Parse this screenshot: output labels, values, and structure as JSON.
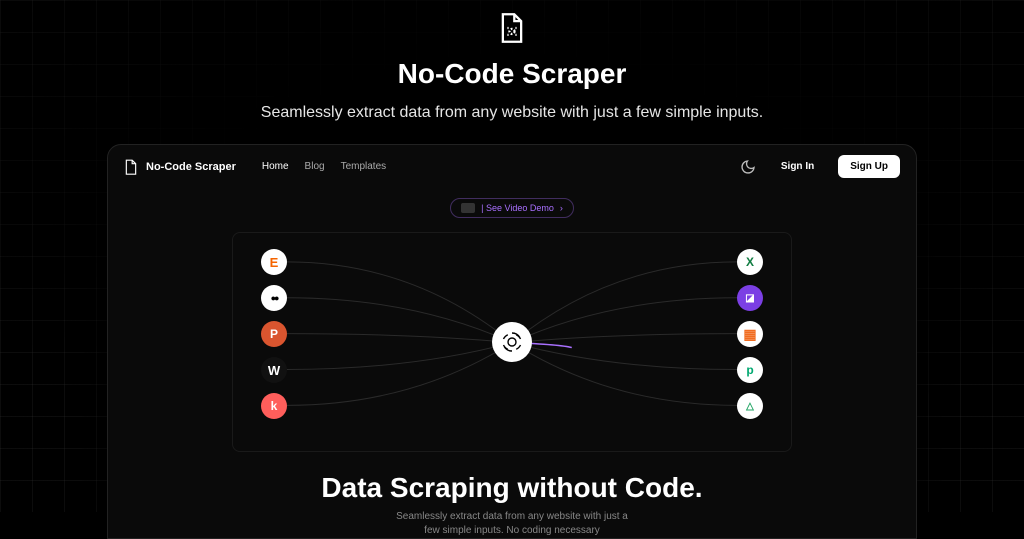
{
  "hero": {
    "title": "No-Code Scraper",
    "subtitle": "Seamlessly extract data from any website with just a few simple inputs."
  },
  "nav": {
    "brand": "No-Code Scraper",
    "links": [
      "Home",
      "Blog",
      "Templates"
    ],
    "signin": "Sign In",
    "signup": "Sign Up"
  },
  "demo": {
    "label": "| See Video Demo",
    "chevron": "›"
  },
  "diagram": {
    "left_nodes": [
      {
        "name": "etsy",
        "glyph": "E",
        "color": "#f56400"
      },
      {
        "name": "medium",
        "glyph": "●●",
        "color": "#000"
      },
      {
        "name": "producthunt",
        "glyph": "P",
        "color": "#da552f"
      },
      {
        "name": "wordpress",
        "glyph": "W",
        "color": "#000"
      },
      {
        "name": "kofi",
        "glyph": "k",
        "color": "#ff5e5b"
      }
    ],
    "right_nodes": [
      {
        "name": "excel",
        "glyph": "X",
        "color": "#107c41"
      },
      {
        "name": "intercom",
        "glyph": "◪",
        "color": "#7b3fe4"
      },
      {
        "name": "sheets",
        "glyph": "▦",
        "color": "#f16c20"
      },
      {
        "name": "paddle",
        "glyph": "p",
        "color": "#00a870"
      },
      {
        "name": "drive",
        "glyph": "△",
        "color": "#1fa463"
      }
    ],
    "center": "openai"
  },
  "inner": {
    "headline": "Data Scraping without Code.",
    "sub1": "Seamlessly extract data from any website with just a",
    "sub2": "few simple inputs. No coding necessary"
  }
}
